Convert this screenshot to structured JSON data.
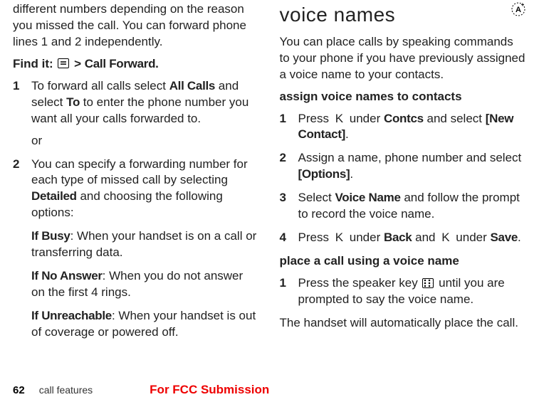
{
  "left": {
    "intro": "different numbers depending on the reason you missed the call. You can forward phone lines 1 and 2 independently.",
    "findit_label": "Find it:",
    "findit_path_sep": ">",
    "findit_path_item": "Call Forward",
    "findit_path_dot": ".",
    "steps": [
      {
        "pre": "To forward all calls select ",
        "b1": "All Calls",
        "mid1": " and select ",
        "b2": "To",
        "post": " to enter the phone number you want all your calls forwarded to.",
        "or": "or"
      },
      {
        "pre": "You can specify a forwarding number for each type of missed call by selecting ",
        "b1": "Detailed",
        "post": " and choosing the following options:",
        "sub": [
          {
            "label": "If Busy",
            "text": ": When your handset is on a call or transferring data."
          },
          {
            "label": "If No Answer",
            "text": ": When you do not answer on the first 4 rings."
          },
          {
            "label": "If Unreachable",
            "text": ": When your handset is out of coverage or powered off."
          }
        ]
      }
    ]
  },
  "right": {
    "heading": "voice names",
    "intro": "You can place calls by speaking commands to your phone if you have previously assigned a voice name to your contacts.",
    "assign_head": "assign voice names to contacts",
    "assign_steps": [
      {
        "pre": "Press ",
        "key": "K",
        "mid": " under ",
        "b1": "Contcs",
        "mid2": " and select ",
        "b2": "[New Contact]",
        "post": "."
      },
      {
        "pre": "Assign a name, phone number and select ",
        "b1": "[Options]",
        "post": "."
      },
      {
        "pre": "Select ",
        "b1": "Voice Name",
        "post": " and follow the prompt to record the voice name."
      },
      {
        "pre": "Press ",
        "key": "K",
        "mid": " under ",
        "b1": "Back",
        "mid2": " and ",
        "key2": "K",
        "mid3": " under ",
        "b2": "Save",
        "post": "."
      }
    ],
    "place_head": "place a call using a voice name",
    "place_steps": [
      {
        "pre": "Press the speaker key ",
        "post": " until you are prompted to say the voice name."
      }
    ],
    "place_end": "The handset will automatically place the call."
  },
  "footer": {
    "page": "62",
    "section": "call features",
    "fcc": "For FCC Submission"
  }
}
